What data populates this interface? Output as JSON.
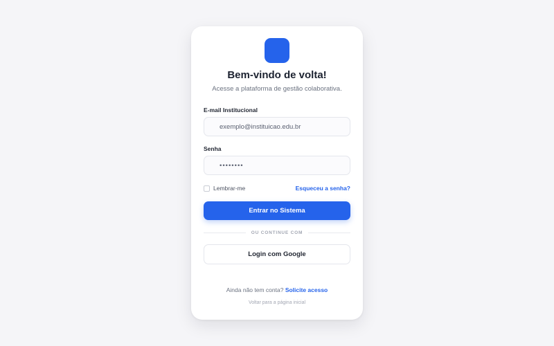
{
  "brand": {
    "accent": "#2563eb",
    "logo_icon": "app-logo-square"
  },
  "header": {
    "title": "Bem-vindo de volta!",
    "subtitle": "Acesse a plataforma de gestão colaborativa."
  },
  "form": {
    "email_label": "E-mail Institucional",
    "email_placeholder": "exemplo@instituicao.edu.br",
    "password_label": "Senha",
    "password_placeholder": "••••••••",
    "remember_label": "Lembrar-me",
    "remember_checked": false,
    "forgot_link": "Esqueceu a senha?",
    "submit_label": "Entrar no Sistema"
  },
  "divider": {
    "text": "OU CONTINUE COM"
  },
  "social": {
    "google_label": "Login com Google"
  },
  "footer": {
    "signup_prompt": "Ainda não tem conta?",
    "signup_link": "Solicite acesso",
    "back_link": "Voltar para a página inicial"
  }
}
